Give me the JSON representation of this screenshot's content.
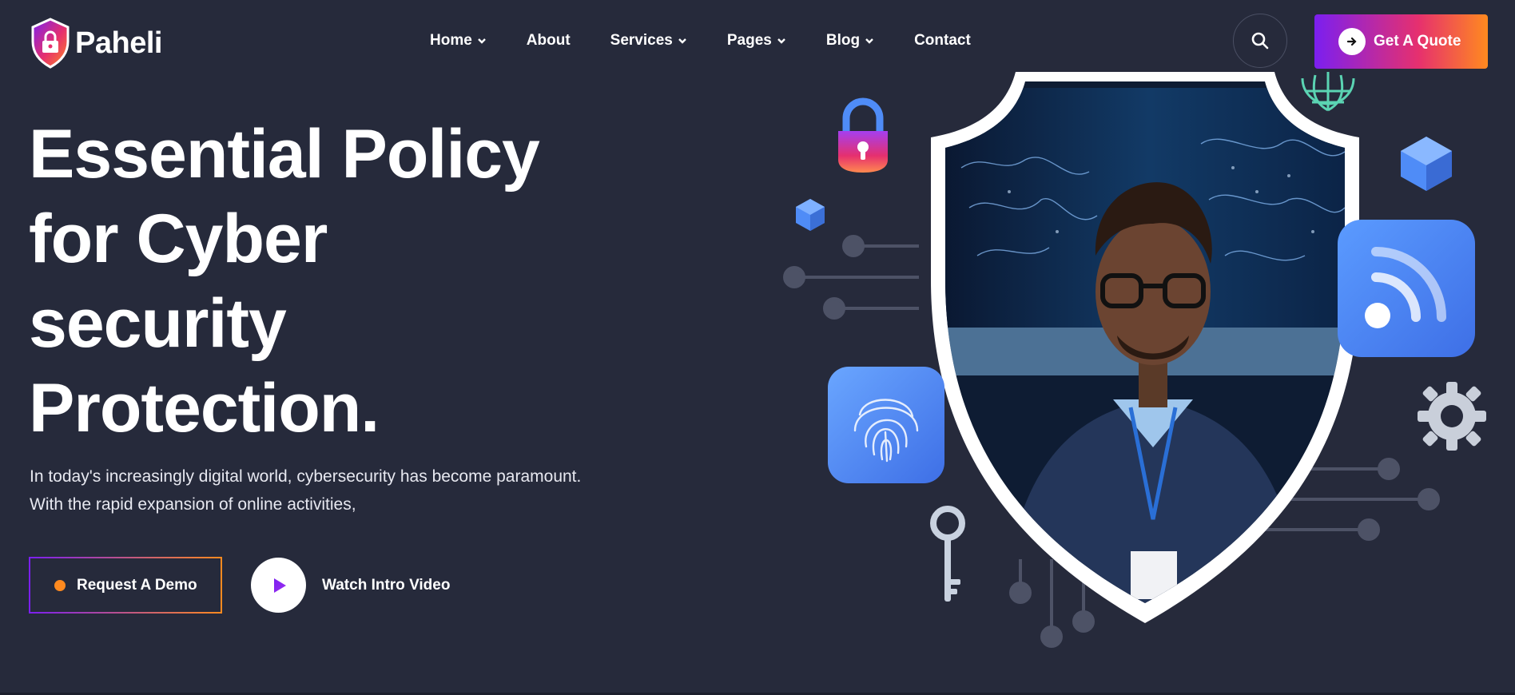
{
  "brand": {
    "name": "Paheli",
    "colors": {
      "background": "#262a3b",
      "gradient_start": "#7b1ff0",
      "gradient_mid": "#e6306e",
      "gradient_end": "#ff8a1f",
      "tile_blue": "#4f8cf7"
    }
  },
  "nav": {
    "items": [
      {
        "label": "Home",
        "dropdown": true
      },
      {
        "label": "About",
        "dropdown": false
      },
      {
        "label": "Services",
        "dropdown": true
      },
      {
        "label": "Pages",
        "dropdown": true
      },
      {
        "label": "Blog",
        "dropdown": true
      },
      {
        "label": "Contact",
        "dropdown": false
      }
    ]
  },
  "header": {
    "search_icon": "search-icon",
    "quote_label": "Get A Quote",
    "quote_icon": "arrow-right-icon"
  },
  "hero": {
    "title_lines": [
      "Essential Policy",
      "for Cyber",
      "security",
      "Protection."
    ],
    "description_lines": [
      "In today's increasingly digital world, cybersecurity has become paramount.",
      "With the rapid expansion of online activities,"
    ],
    "demo_label": "Request A Demo",
    "video_label": "Watch Intro Video",
    "illustration_icons": [
      "padlock-icon",
      "globe-icon",
      "cube-icon",
      "rss-icon",
      "fingerprint-icon",
      "gear-icon",
      "key-icon"
    ]
  }
}
